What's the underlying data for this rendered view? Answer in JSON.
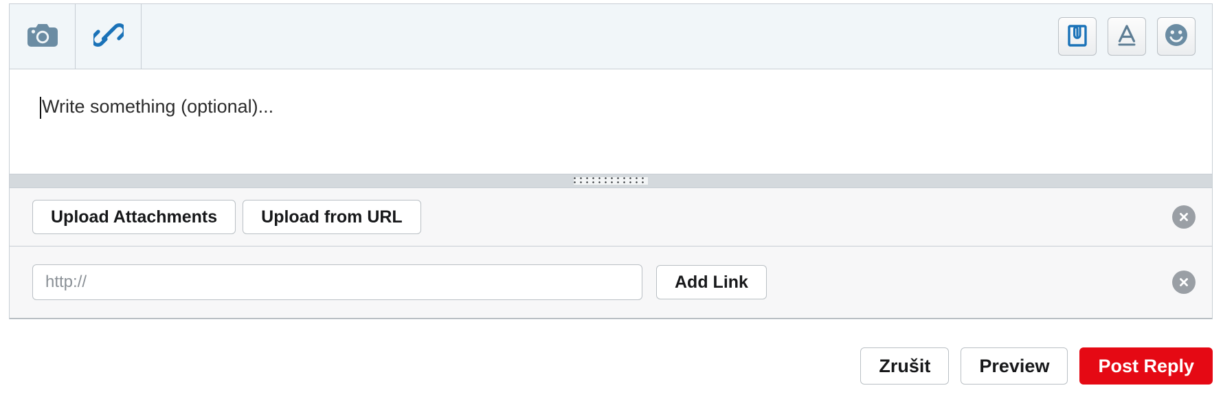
{
  "toolbar": {
    "left_tools": [
      {
        "name": "camera-icon",
        "label": "Insert image"
      },
      {
        "name": "link-icon",
        "label": "Insert link"
      }
    ],
    "right_tools": [
      {
        "name": "clipboard-attachment-icon",
        "label": "Attachments"
      },
      {
        "name": "text-format-icon",
        "label": "Text formatting"
      },
      {
        "name": "emoji-icon",
        "label": "Emoticons"
      }
    ]
  },
  "compose": {
    "placeholder": "Write something (optional)...",
    "value": ""
  },
  "resize": {
    "name": "resize-grip"
  },
  "attachments_row": {
    "upload_attachments_label": "Upload Attachments",
    "upload_from_url_label": "Upload from URL",
    "close_label": "×"
  },
  "link_row": {
    "url_placeholder": "http://",
    "url_value": "",
    "add_link_label": "Add Link",
    "close_label": "×"
  },
  "actions": {
    "cancel_label": "Zrušit",
    "preview_label": "Preview",
    "post_label": "Post Reply"
  },
  "colors": {
    "primary_red": "#e50914",
    "toolbar_bg": "#f1f6f9",
    "border": "#c7ced4",
    "icon_slate": "#6b8ca3",
    "icon_blue": "#1a72b8",
    "close_gray": "#9a9fa5"
  }
}
